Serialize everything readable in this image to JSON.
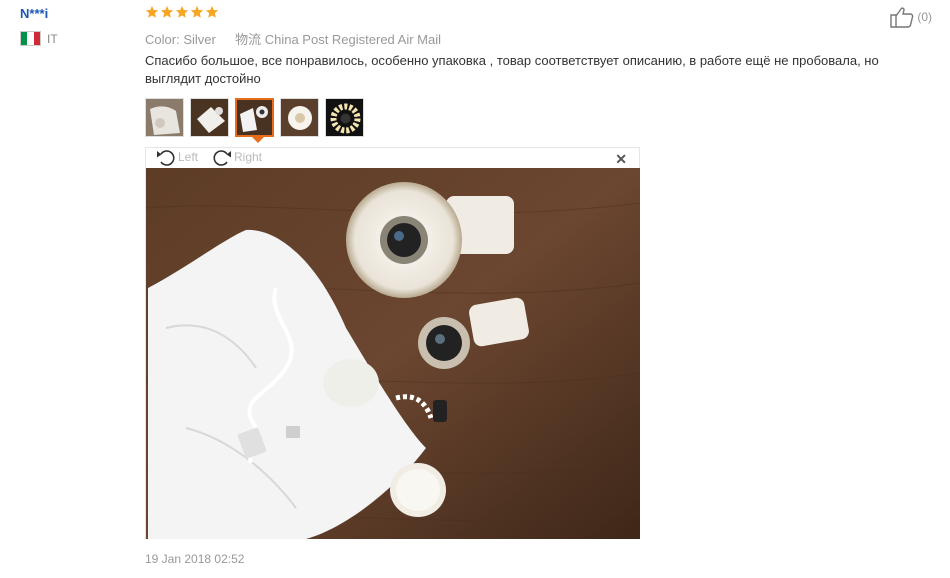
{
  "reviewer": {
    "name": "N***i",
    "country": "IT",
    "flag_colors": [
      "#009246",
      "#ffffff",
      "#ce2b37"
    ]
  },
  "rating": {
    "stars": 5,
    "max": 5,
    "color": "#f5a623"
  },
  "details": {
    "color_label": "Color:",
    "color_value": "Silver",
    "shipping_label": "物流",
    "shipping_value": "China Post Registered Air Mail"
  },
  "helpful": {
    "icon": "thumbs-up-icon",
    "count": "(0)"
  },
  "review_text": "Спасибо большое, все понравилось, особенно упаковка , товар соответствует описанию, в работе ещё не пробовала, но выглядит достойно",
  "photos": {
    "count": 5,
    "selected_index": 2,
    "accent": "#e86d1a"
  },
  "viewer": {
    "rotate_left_label": "Left",
    "rotate_right_label": "Right",
    "close_symbol": "✕"
  },
  "date": "19 Jan 2018 02:52"
}
